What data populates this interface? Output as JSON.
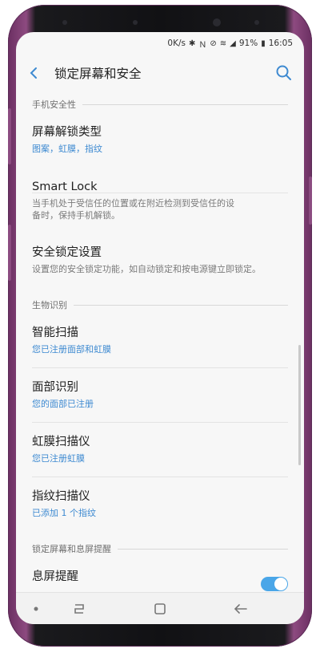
{
  "status": {
    "speed": "0K/s",
    "battery": "91%",
    "time": "16:05"
  },
  "appbar": {
    "title": "锁定屏幕和安全"
  },
  "sections": {
    "phone_security": "手机安全性",
    "biometrics": "生物识别",
    "lock_screen_aod": "锁定屏幕和息屏提醒"
  },
  "items": {
    "screen_lock_type": {
      "title": "屏幕解锁类型",
      "subtitle": "图案，虹膜，指纹"
    },
    "smart_lock": {
      "title": "Smart Lock",
      "subtitle_line1": "当手机处于受信任的位置或在附近检测到受信任的设",
      "subtitle_line2": "备时，保持手机解锁。"
    },
    "secure_lock": {
      "title": "安全锁定设置",
      "subtitle": "设置您的安全锁定功能，如自动锁定和按电源键立即锁定。"
    },
    "intelligent_scan": {
      "title": "智能扫描",
      "subtitle": "您已注册面部和虹膜"
    },
    "face_recognition": {
      "title": "面部识别",
      "subtitle": "您的面部已注册"
    },
    "iris_scanner": {
      "title": "虹膜扫描仪",
      "subtitle": "您已注册虹膜"
    },
    "fingerprint_scanner": {
      "title": "指纹扫描仪",
      "subtitle": "已添加 1 个指纹"
    },
    "always_on_display": {
      "title": "息屏提醒",
      "enabled": true
    }
  },
  "colors": {
    "accent": "#3e8ad1",
    "toggle_on": "#4aa6e8",
    "frame": "#8b4c80"
  }
}
